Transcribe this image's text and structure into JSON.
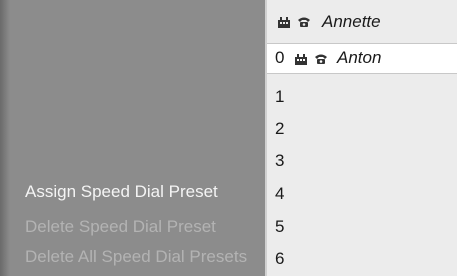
{
  "menu": {
    "items": [
      {
        "label": "Assign Speed Dial Preset",
        "state": "active"
      },
      {
        "label": "Delete Speed Dial Preset",
        "state": "disabled"
      },
      {
        "label": "Delete All Speed Dial Presets",
        "state": "disabled"
      }
    ]
  },
  "list": {
    "header": {
      "name": "Annette",
      "icons": [
        "building-icon",
        "phone-icon"
      ]
    },
    "selected": {
      "number": "0",
      "name": "Anton",
      "icons": [
        "building-icon",
        "phone-icon"
      ]
    },
    "slots": [
      "1",
      "2",
      "3",
      "4",
      "5",
      "6"
    ]
  },
  "colors": {
    "panel": "#ececec",
    "background": "#8c8c8c",
    "active_text": "#f4f4f4",
    "disabled_text": "#b3b3b3"
  }
}
